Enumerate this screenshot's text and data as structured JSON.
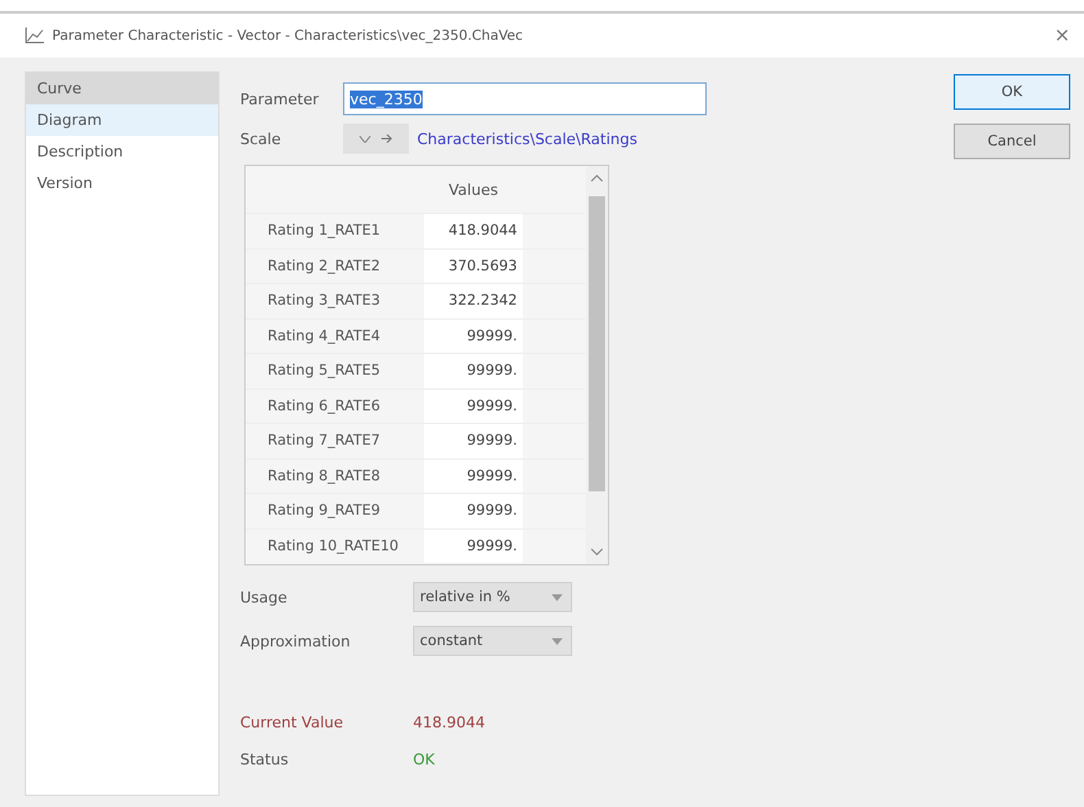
{
  "window": {
    "title": "Parameter Characteristic - Vector - Characteristics\\vec_2350.ChaVec",
    "close": "×"
  },
  "sidebar": {
    "items": [
      {
        "label": "Curve",
        "selected": true,
        "hovered": false
      },
      {
        "label": "Diagram",
        "selected": false,
        "hovered": true
      },
      {
        "label": "Description",
        "selected": false,
        "hovered": false
      },
      {
        "label": "Version",
        "selected": false,
        "hovered": false
      }
    ]
  },
  "parameter": {
    "label": "Parameter",
    "value": "vec_2350"
  },
  "scale": {
    "label": "Scale",
    "link": "Characteristics\\Scale\\Ratings"
  },
  "table": {
    "columns": [
      "Values"
    ],
    "rows": [
      {
        "name": "Rating 1_RATE1",
        "value": "418.9044"
      },
      {
        "name": "Rating 2_RATE2",
        "value": "370.5693"
      },
      {
        "name": "Rating 3_RATE3",
        "value": "322.2342"
      },
      {
        "name": "Rating 4_RATE4",
        "value": "99999."
      },
      {
        "name": "Rating 5_RATE5",
        "value": "99999."
      },
      {
        "name": "Rating 6_RATE6",
        "value": "99999."
      },
      {
        "name": "Rating 7_RATE7",
        "value": "99999."
      },
      {
        "name": "Rating 8_RATE8",
        "value": "99999."
      },
      {
        "name": "Rating 9_RATE9",
        "value": "99999."
      },
      {
        "name": "Rating 10_RATE10",
        "value": "99999."
      }
    ]
  },
  "usage": {
    "label": "Usage",
    "value": "relative in %"
  },
  "approximation": {
    "label": "Approximation",
    "value": "constant"
  },
  "current_value": {
    "label": "Current Value",
    "value": "418.9044"
  },
  "status": {
    "label": "Status",
    "value": "OK"
  },
  "buttons": [
    "OK",
    "Cancel"
  ]
}
